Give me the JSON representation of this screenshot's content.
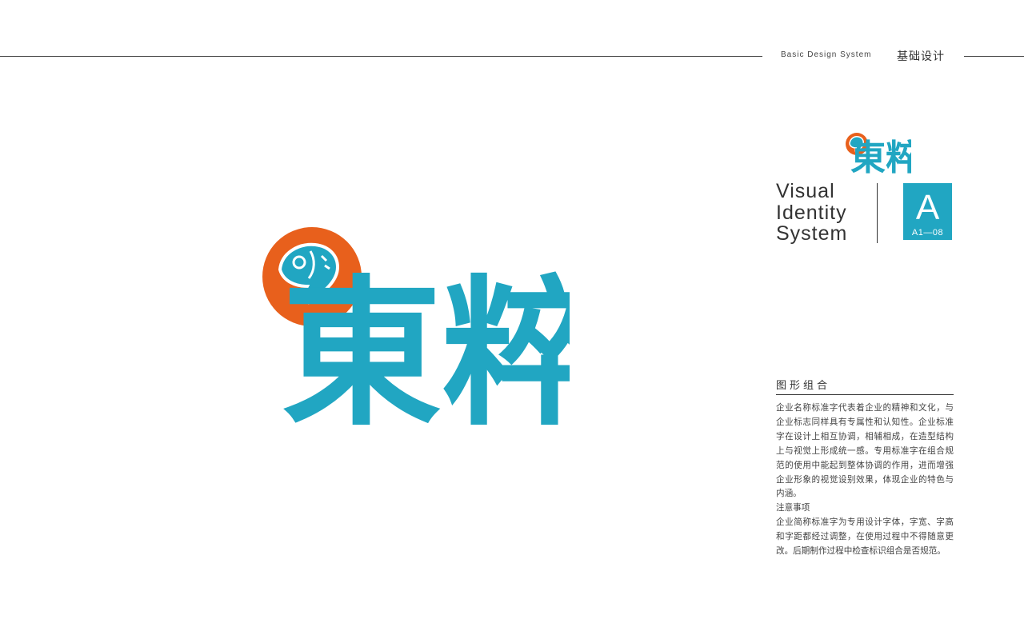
{
  "header": {
    "subtitle_en": "Basic Design System",
    "subtitle_cn": "基础设计"
  },
  "logo": {
    "text": "東粹",
    "colors": {
      "teal": "#21a6c2",
      "orange": "#e8601c",
      "white": "#ffffff"
    },
    "icon": "fish-icon"
  },
  "identity": {
    "line1": "Visual",
    "line2": "Identity",
    "line3": "System",
    "badge_letter": "A",
    "badge_code": "A1—08",
    "badge_color": "#21a6c2"
  },
  "section": {
    "title": "图形组合",
    "paragraph1": "企业名称标准字代表着企业的精神和文化，与企业标志同样具有专属性和认知性。企业标准字在设计上相互协调，相辅相成，在造型结构上与视觉上形成统一感。专用标准字在组合规范的使用中能起到整体协调的作用，进而增强企业形象的视觉设别效果，体现企业的特色与内涵。",
    "note_title": "注意事项",
    "paragraph2": "企业简称标准字为专用设计字体，字宽、字高和字距都经过调整，在使用过程中不得随意更改。后期制作过程中检查标识组合是否规范。"
  }
}
